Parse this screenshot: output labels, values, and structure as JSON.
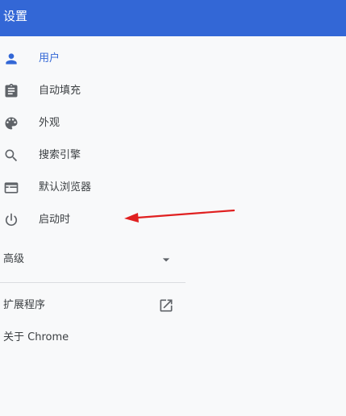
{
  "header": {
    "title": "设置"
  },
  "nav": {
    "items": [
      {
        "label": "用户",
        "icon": "person-icon"
      },
      {
        "label": "自动填充",
        "icon": "clipboard-icon"
      },
      {
        "label": "外观",
        "icon": "palette-icon"
      },
      {
        "label": "搜索引擎",
        "icon": "search-icon"
      },
      {
        "label": "默认浏览器",
        "icon": "browser-window-icon"
      },
      {
        "label": "启动时",
        "icon": "power-icon"
      }
    ],
    "active_item": "用户"
  },
  "advanced": {
    "label": "高级",
    "icon": "chevron-down-icon"
  },
  "extensions": {
    "label": "扩展程序",
    "icon": "external-link-icon"
  },
  "about": {
    "label": "关于 Chrome"
  },
  "colors": {
    "header_bg": "#3367d6",
    "accent": "#3367d6",
    "icon": "#5f6368",
    "annotation_arrow": "#e02020"
  }
}
